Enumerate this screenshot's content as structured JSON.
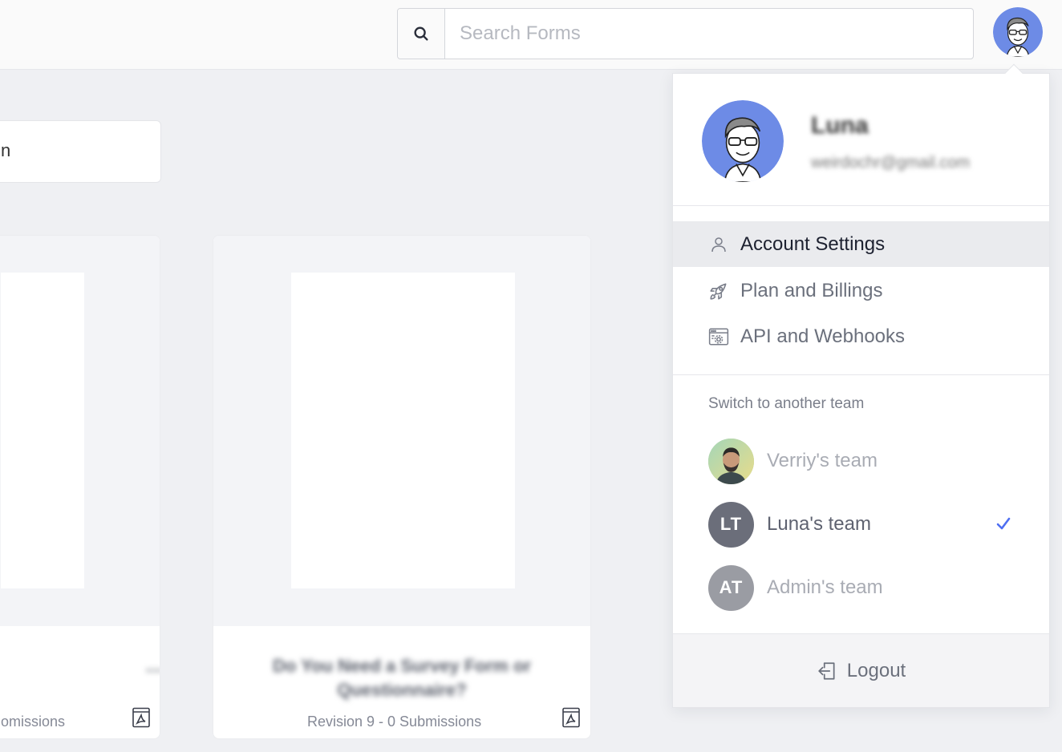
{
  "header": {
    "search_placeholder": "Search Forms"
  },
  "background": {
    "search_card_text": "n",
    "cards": [
      {
        "title": "…",
        "meta": "omissions"
      },
      {
        "title": "Do You Need a Survey Form or Questionnaire?",
        "meta": "Revision 9 - 0 Submissions"
      }
    ]
  },
  "dropdown": {
    "user_name": "Luna",
    "user_email": "weirdochr@gmail.com",
    "menu": [
      {
        "label": "Account Settings",
        "icon": "user-icon",
        "active": true
      },
      {
        "label": "Plan and Billings",
        "icon": "rocket-icon",
        "active": false
      },
      {
        "label": "API and Webhooks",
        "icon": "browser-settings-icon",
        "active": false
      }
    ],
    "switch_title": "Switch to another team",
    "teams": [
      {
        "name": "Verriy's team",
        "initials": "",
        "avatar_color": "#a8c8a0",
        "current": false
      },
      {
        "name": "Luna's team",
        "initials": "LT",
        "avatar_color": "#6b6e7a",
        "current": true
      },
      {
        "name": "Admin's team",
        "initials": "AT",
        "avatar_color": "#9a9ca3",
        "current": false
      }
    ],
    "logout_label": "Logout"
  },
  "colors": {
    "accent": "#4e6ef2",
    "avatar_bg": "#6d8be6"
  }
}
